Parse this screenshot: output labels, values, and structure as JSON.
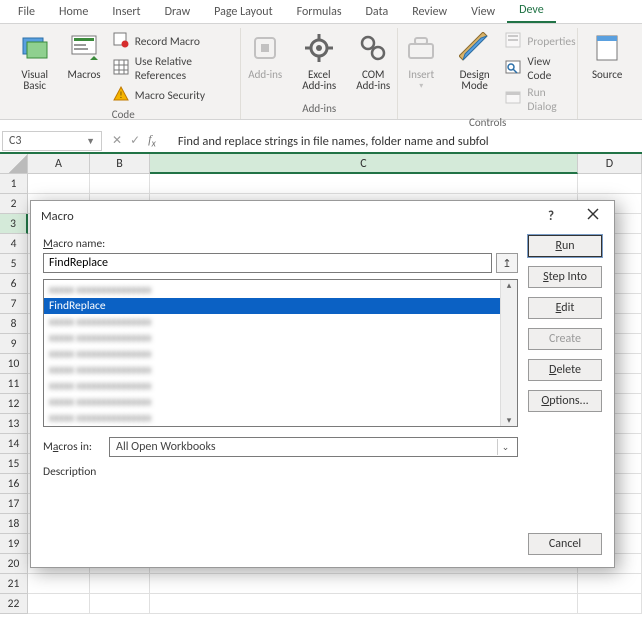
{
  "tabs": {
    "file": "File",
    "home": "Home",
    "insert": "Insert",
    "draw": "Draw",
    "page_layout": "Page Layout",
    "formulas": "Formulas",
    "data": "Data",
    "review": "Review",
    "view": "View",
    "developer": "Deve"
  },
  "ribbon": {
    "code": {
      "visual_basic": "Visual Basic",
      "macros": "Macros",
      "record_macro": "Record Macro",
      "use_rel_refs": "Use Relative References",
      "macro_security": "Macro Security",
      "label": "Code"
    },
    "addins": {
      "addins": "Add-ins",
      "excel_addins": "Excel Add-ins",
      "com_addins": "COM Add-ins",
      "label": "Add-ins"
    },
    "controls": {
      "insert_btn": "Insert",
      "design_mode": "Design Mode",
      "properties": "Properties",
      "view_code": "View Code",
      "run_dialog": "Run Dialog",
      "label": "Controls"
    },
    "source_btn": "Source"
  },
  "namebox": "C3",
  "formula_bar": "Find and replace strings in file names, folder name and subfol",
  "columns": [
    "A",
    "B",
    "C",
    "D"
  ],
  "row_count": 22,
  "selected_cell": {
    "col": "C",
    "row": 3
  },
  "column_widths": {
    "A": 62,
    "B": 60,
    "C": 428,
    "D": 64
  },
  "dialog": {
    "title": "Macro",
    "macro_name_label": "Macro name:",
    "macro_name_value": "FindReplace",
    "list": [
      "—",
      "FindReplace",
      "—",
      "—",
      "—",
      "—",
      "—",
      "—",
      "—"
    ],
    "selected_index": 1,
    "macros_in_label": "Macros in:",
    "macros_in_value": "All Open Workbooks",
    "description_label": "Description",
    "buttons": {
      "run": "Run",
      "step_into": "Step Into",
      "edit": "Edit",
      "create": "Create",
      "delete": "Delete",
      "options": "Options...",
      "cancel": "Cancel"
    }
  }
}
